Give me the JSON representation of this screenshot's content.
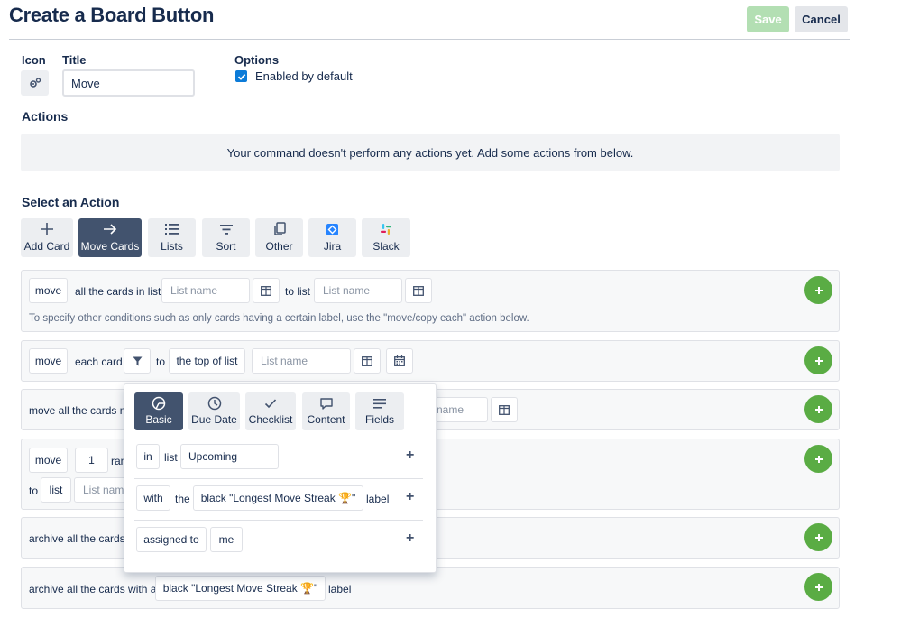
{
  "header": {
    "title": "Create a Board Button",
    "save_label": "Save",
    "cancel_label": "Cancel"
  },
  "form": {
    "icon_label": "Icon",
    "title_label": "Title",
    "title_value": "Move",
    "options_label": "Options",
    "enabled_label": "Enabled by default",
    "enabled_checked": true
  },
  "actions": {
    "heading": "Actions",
    "empty_message": "Your command doesn't perform any actions yet. Add some actions from below."
  },
  "select_action": {
    "heading": "Select an Action",
    "tabs": [
      {
        "label": "Add Card",
        "icon": "plus-icon",
        "active": false
      },
      {
        "label": "Move Cards",
        "icon": "arrow-right-icon",
        "active": true
      },
      {
        "label": "Lists",
        "icon": "list-icon",
        "active": false
      },
      {
        "label": "Sort",
        "icon": "sort-icon",
        "active": false
      },
      {
        "label": "Other",
        "icon": "copy-icon",
        "active": false
      },
      {
        "label": "Jira",
        "icon": "jira-icon",
        "active": false
      },
      {
        "label": "Slack",
        "icon": "slack-icon",
        "active": false
      }
    ]
  },
  "rows": {
    "r1": {
      "verb": "move",
      "text1": "all the cards in list",
      "list1_placeholder": "List name",
      "text2": "to list",
      "list2_placeholder": "List name",
      "hint": "To specify other conditions such as only cards having a certain label, use the \"move/copy each\" action below."
    },
    "r2": {
      "verb": "move",
      "text1": "each card",
      "text2": "to",
      "position": "the top of list",
      "list_placeholder": "List name"
    },
    "r3": {
      "text1": "move all the cards m",
      "list_placeholder_tail": "name"
    },
    "r4": {
      "verb": "move",
      "count": "1",
      "text1": "ran",
      "text2": "to",
      "target": "list",
      "list_placeholder": "List nam"
    },
    "r5": {
      "text1": "archive all the cards"
    },
    "r6": {
      "text1": "archive all the cards with a",
      "label_value": "black \"Longest Move Streak 🏆\"",
      "text2": "label"
    }
  },
  "filter_popover": {
    "tabs": [
      {
        "label": "Basic",
        "icon": "tag-icon",
        "active": true
      },
      {
        "label": "Due Date",
        "icon": "clock-icon",
        "active": false
      },
      {
        "label": "Checklist",
        "icon": "check-icon",
        "active": false
      },
      {
        "label": "Content",
        "icon": "comment-icon",
        "active": false
      },
      {
        "label": "Fields",
        "icon": "fields-icon",
        "active": false
      }
    ],
    "row1": {
      "op": "in",
      "text": "list",
      "value": "Upcoming"
    },
    "row2": {
      "op": "with",
      "text1": "the",
      "value": "black \"Longest Move Streak 🏆\"",
      "text2": "label"
    },
    "row3": {
      "op": "assigned to",
      "value": "me"
    }
  },
  "colors": {
    "accent_green": "#5aac44",
    "save_disabled": "#b3dfb3",
    "active_tab": "#42536e",
    "checkbox_blue": "#0c7bd8",
    "jira_blue": "#2684ff"
  }
}
